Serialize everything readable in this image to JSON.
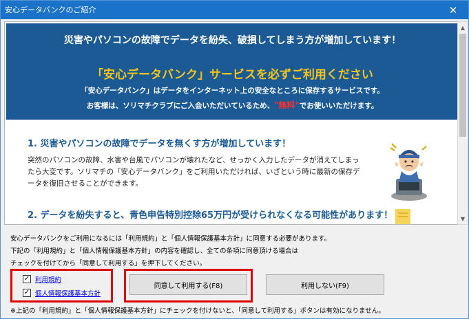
{
  "window": {
    "title": "安心データバンクのご紹介",
    "close_glyph": "✕"
  },
  "banner": {
    "line1": "災害やパソコンの故障でデータを紛失、破損してしまう方が増加しています！",
    "line2": "「安心データバンク」サービスを必ずご利用ください",
    "line3": "「安心データバンク」はデータをインターネット上の安全なところに保存するサービスです。",
    "line4_before": "お客様は、ソリマチクラブにご入会いただいているため、",
    "line4_free": "\"無料\"",
    "line4_after": "でお使いいただけます。"
  },
  "section1": {
    "title": "1. 災害やパソコンの故障でデータを無くす方が増加しています！",
    "body": "突然のパソコンの故障、水害や台風でパソコンが壊れたなど、せっかく入力したデータが消えてしまったら大変です。ソリマチの「安心データバンク」をご利用いただければ、いざという時に最新の保存データを復旧させることができます。"
  },
  "section2": {
    "title": "2. データを紛失すると、青色申告特別控除65万円が受けられなくなる可能性があります！"
  },
  "notice": {
    "line1": "安心データバンクをご利用になるには「利用規約」と「個人情報保護基本方針」に同意する必要があります。",
    "line2": "下記の「利用規約」と「個人情報保護基本方針」の内容を確認し、全ての条項に同意頂ける場合は",
    "line3": "チェックを付けてから「同意して利用する」を押下してください。"
  },
  "checkboxes": {
    "terms": {
      "label": "利用規約",
      "checked_glyph": "✓"
    },
    "privacy": {
      "label": "個人情報保護基本方針",
      "checked_glyph": "✓"
    }
  },
  "buttons": {
    "agree": "同意して利用する(F8)",
    "disagree": "利用しない(F9)"
  },
  "footnote": "※上記の「利用規約」と「個人情報保護基本方針」にチェックを付けないと、「同意して利用する」ボタンは有効になりません。",
  "scrollbar": {
    "up_glyph": "▲",
    "down_glyph": "▼"
  },
  "colors": {
    "titlebar": "#1a73c9",
    "banner": "#1b5a94",
    "banner_headline": "#f5c518",
    "free_text": "#ff3030",
    "section_title": "#1b5a94",
    "highlight_box": "#e00000",
    "link": "#0000e0"
  },
  "icons": {
    "illustration1": "worried-technician-illustration",
    "illustration2": "document-illustration"
  }
}
